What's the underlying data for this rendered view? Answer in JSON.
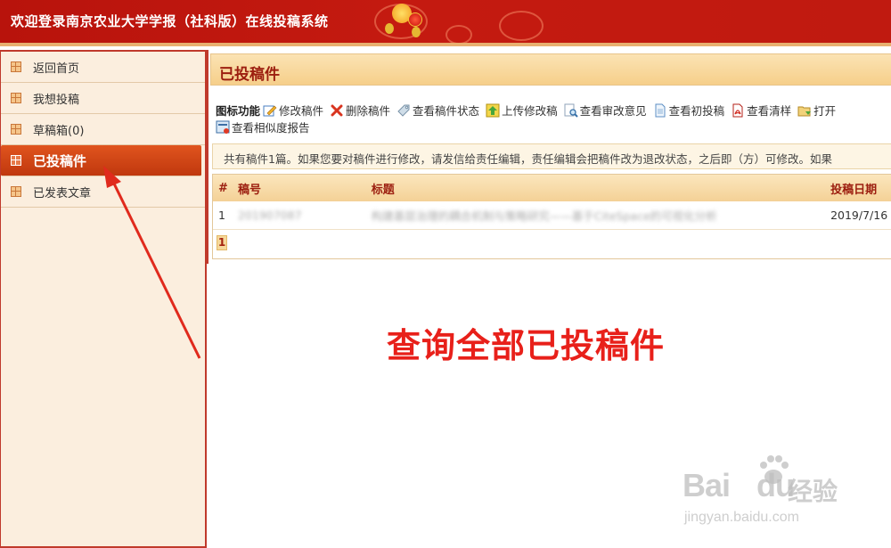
{
  "header": {
    "title": "欢迎登录南京农业大学学报（社科版）在线投稿系统"
  },
  "sidebar": {
    "items": [
      {
        "label": "返回首页",
        "active": false
      },
      {
        "label": "我想投稿",
        "active": false
      },
      {
        "label": "草稿箱(0)",
        "active": false
      },
      {
        "label": "已投稿件",
        "active": true
      },
      {
        "label": "已发表文章",
        "active": false
      }
    ]
  },
  "main": {
    "page_title": "已投稿件",
    "toolbar": {
      "caption": "图标功能",
      "items": [
        {
          "label": "修改稿件",
          "icon": "edit-icon"
        },
        {
          "label": "删除稿件",
          "icon": "delete-icon"
        },
        {
          "label": "查看稿件状态",
          "icon": "tag-icon"
        },
        {
          "label": "上传修改稿",
          "icon": "upload-icon"
        },
        {
          "label": "查看审改意见",
          "icon": "magnifier-icon"
        },
        {
          "label": "查看初投稿",
          "icon": "document-icon"
        },
        {
          "label": "查看清样",
          "icon": "pdf-icon"
        },
        {
          "label": "打开",
          "icon": "folder-open-icon"
        }
      ],
      "second_row": [
        {
          "label": "查看相似度报告",
          "icon": "report-icon"
        }
      ]
    },
    "notice": "共有稿件1篇。如果您要对稿件进行修改，请发信给责任编辑，责任编辑会把稿件改为退改状态，之后即（方）可修改。如果",
    "table": {
      "headers": [
        "#",
        "稿号",
        "标题",
        "投稿日期"
      ],
      "rows": [
        {
          "index": "1",
          "number": "201907087",
          "title": "构建基层治理的耦合机制与策略研究——基于CiteSpace的可视化分析",
          "date": "2019/7/16"
        }
      ]
    },
    "pager": {
      "current": "1"
    }
  },
  "annotation": {
    "text": "查询全部已投稿件"
  },
  "watermark": {
    "brand": "Bai",
    "brand2": "du",
    "cn": "经验",
    "url": "jingyan.baidu.com"
  },
  "colors": {
    "header_red": "#c01a10",
    "sidebar_bg": "#fbeede",
    "active_orange": "#d9481a",
    "title_red": "#9c1e0f",
    "annotation_red": "#e8201a"
  }
}
